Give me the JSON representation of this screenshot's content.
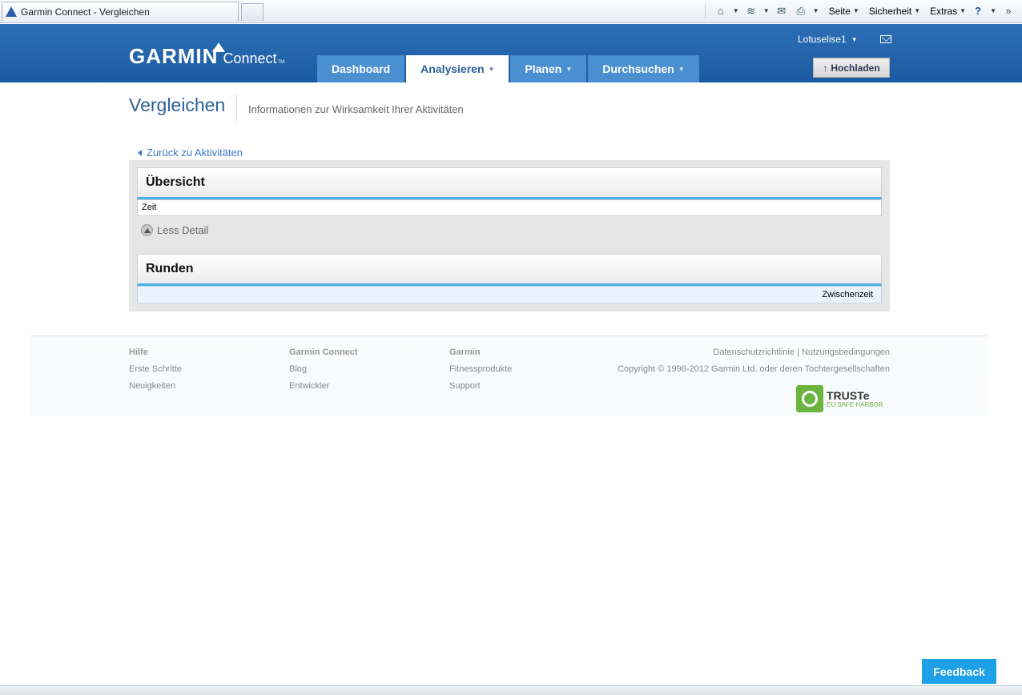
{
  "browser": {
    "tab_title": "Garmin Connect - Vergleichen",
    "commands": {
      "page": "Seite",
      "security": "Sicherheit",
      "extras": "Extras"
    }
  },
  "header": {
    "logo_garmin": "GARMIN",
    "logo_connect": "Connect",
    "logo_tm": "TM",
    "username": "Lotuselise1",
    "upload_label": "Hochladen",
    "nav": [
      {
        "label": "Dashboard"
      },
      {
        "label": "Analysieren"
      },
      {
        "label": "Planen"
      },
      {
        "label": "Durchsuchen"
      }
    ]
  },
  "page": {
    "title": "Vergleichen",
    "subtitle": "Informationen zur Wirksamkeit Ihrer Aktivitäten",
    "back_link": "Zurück zu Aktivitäten"
  },
  "overview": {
    "heading": "Übersicht",
    "row_label": "Zeit",
    "less_detail": "Less Detail"
  },
  "laps": {
    "heading": "Runden",
    "column": "Zwischenzeit"
  },
  "footer": {
    "col1": {
      "heading": "Hilfe",
      "links": [
        "Erste Schritte",
        "Neuigkeiten"
      ]
    },
    "col2": {
      "heading": "Garmin Connect",
      "links": [
        "Blog",
        "Entwickler"
      ]
    },
    "col3": {
      "heading": "Garmin",
      "links": [
        "Fitnessprodukte",
        "Support"
      ]
    },
    "privacy": "Datenschutzrichtlinie",
    "terms": "Nutzungsbedingungen",
    "copyright": "Copyright © 1996-2012 Garmin Ltd. oder deren Tochtergesellschaften",
    "truste_title": "TRUSTe",
    "truste_sub": "EU SAFE HARBOR"
  },
  "feedback_label": "Feedback",
  "colors": {
    "header_blue": "#2d6fb7",
    "accent_blue": "#46b2e8",
    "feedback_blue": "#1ea1e6"
  }
}
